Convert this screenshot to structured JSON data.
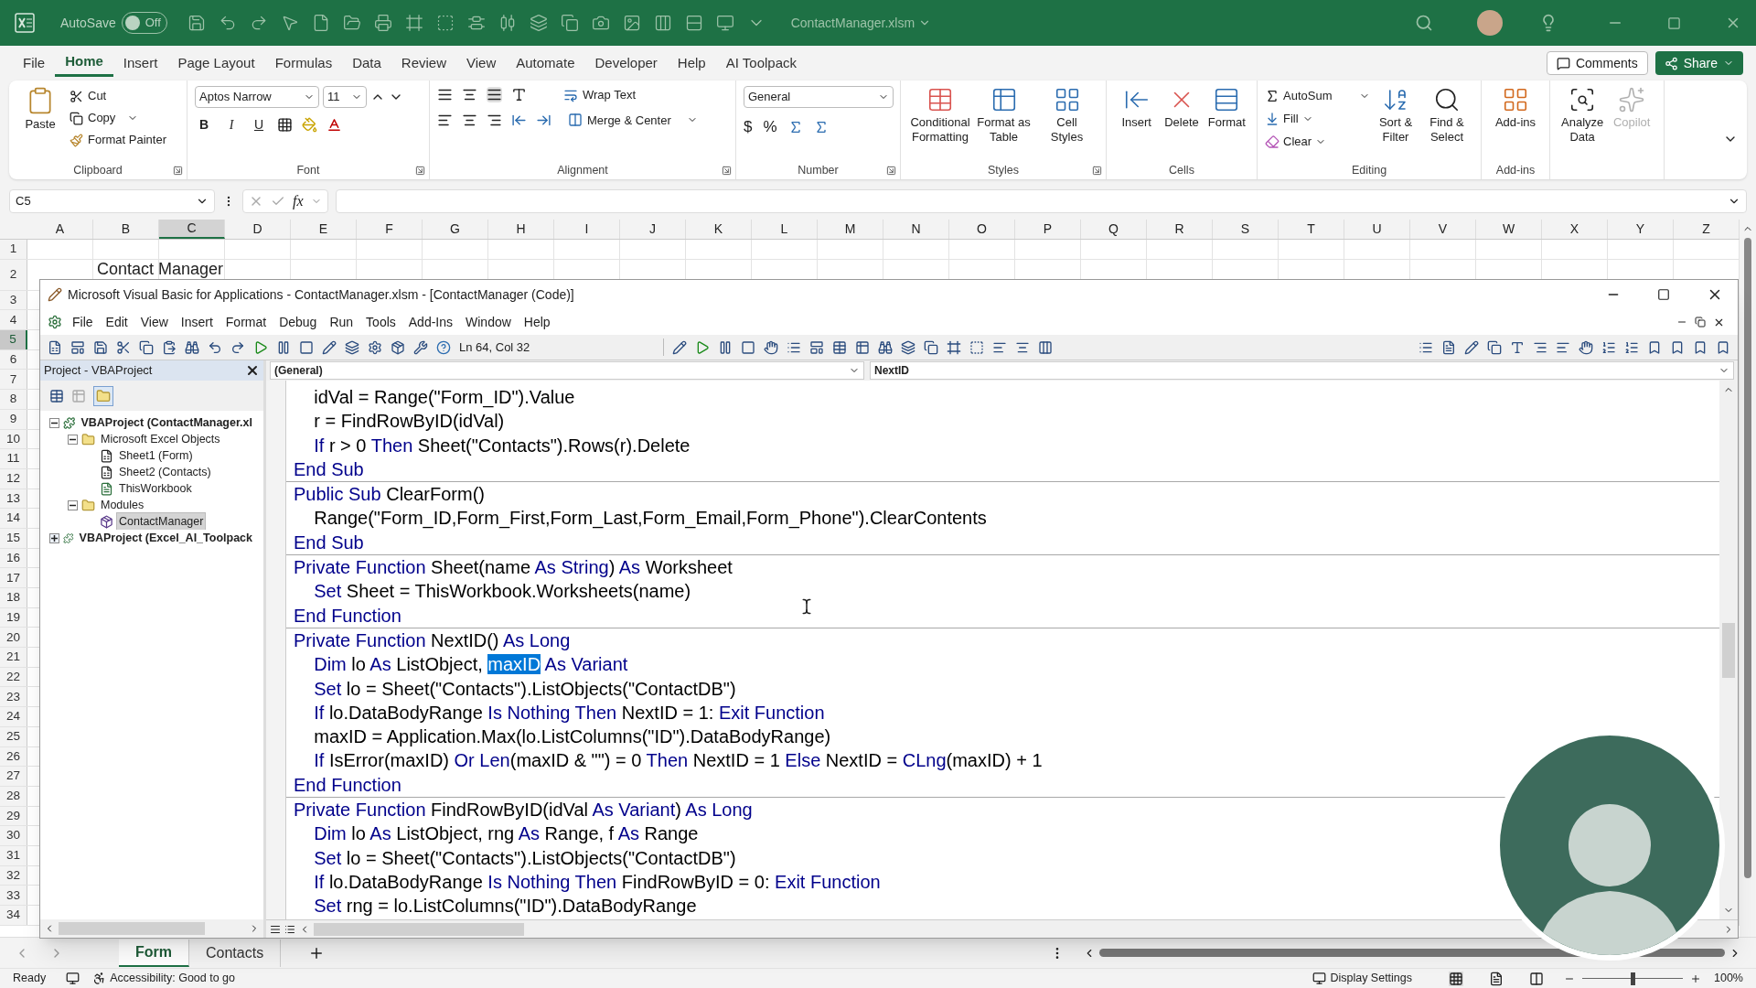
{
  "title_bar": {
    "autosave_label": "AutoSave",
    "autosave": {
      "on": false,
      "label": "Off"
    },
    "file_name": "ContactManager.xlsm"
  },
  "ribbon_tabs": [
    {
      "label": "File",
      "selected": false
    },
    {
      "label": "Home",
      "selected": true
    },
    {
      "label": "Insert",
      "selected": false
    },
    {
      "label": "Page Layout",
      "selected": false
    },
    {
      "label": "Formulas",
      "selected": false
    },
    {
      "label": "Data",
      "selected": false
    },
    {
      "label": "Review",
      "selected": false
    },
    {
      "label": "View",
      "selected": false
    },
    {
      "label": "Automate",
      "selected": false
    },
    {
      "label": "Developer",
      "selected": false
    },
    {
      "label": "Help",
      "selected": false
    },
    {
      "label": "AI Toolpack",
      "selected": false
    }
  ],
  "comments_button": "Comments",
  "share_button": "Share",
  "ribbon": {
    "clipboard": {
      "label": "Clipboard",
      "paste": "Paste",
      "cut": "Cut",
      "copy": "Copy",
      "format_painter": "Format Painter"
    },
    "font": {
      "label": "Font",
      "font_name": "Aptos Narrow",
      "font_size": "11",
      "styles": [
        "B",
        "I",
        "U"
      ]
    },
    "alignment": {
      "label": "Alignment",
      "wrap_text": "Wrap Text",
      "merge_center": "Merge & Center"
    },
    "number": {
      "label": "Number",
      "format": "General",
      "currency": "$",
      "percent": "%"
    },
    "styles": {
      "label": "Styles",
      "buttons": [
        "Conditional Formatting",
        "Format as Table",
        "Cell Styles"
      ]
    },
    "cells": {
      "label": "Cells",
      "buttons": [
        "Insert",
        "Delete",
        "Format"
      ]
    },
    "editing": {
      "label": "Editing",
      "autosum": "AutoSum",
      "fill": "Fill",
      "clear": "Clear",
      "buttons": [
        "Sort & Filter",
        "Find & Select"
      ]
    },
    "addins": {
      "label": "Add-ins",
      "button": "Add-ins"
    },
    "extra": [
      {
        "label": "Analyze Data",
        "disabled": false
      },
      {
        "label": "Copilot",
        "disabled": true
      }
    ]
  },
  "formula_bar": {
    "name_box": "C5",
    "function_label": "fx"
  },
  "sheet": {
    "columns": [
      {
        "label": "A",
        "selected": false
      },
      {
        "label": "B",
        "selected": false
      },
      {
        "label": "C",
        "selected": true
      },
      {
        "label": "D",
        "selected": false
      },
      {
        "label": "E",
        "selected": false
      },
      {
        "label": "F",
        "selected": false
      },
      {
        "label": "G",
        "selected": false
      },
      {
        "label": "H",
        "selected": false
      },
      {
        "label": "I",
        "selected": false
      },
      {
        "label": "J",
        "selected": false
      },
      {
        "label": "K",
        "selected": false
      },
      {
        "label": "L",
        "selected": false
      },
      {
        "label": "M",
        "selected": false
      },
      {
        "label": "N",
        "selected": false
      },
      {
        "label": "O",
        "selected": false
      },
      {
        "label": "P",
        "selected": false
      },
      {
        "label": "Q",
        "selected": false
      },
      {
        "label": "R",
        "selected": false
      },
      {
        "label": "S",
        "selected": false
      },
      {
        "label": "T",
        "selected": false
      },
      {
        "label": "U",
        "selected": false
      },
      {
        "label": "V",
        "selected": false
      },
      {
        "label": "W",
        "selected": false
      },
      {
        "label": "X",
        "selected": false
      },
      {
        "label": "Y",
        "selected": false
      },
      {
        "label": "Z",
        "selected": false
      }
    ],
    "rows": [
      {
        "label": "1",
        "selected": false
      },
      {
        "label": "2",
        "selected": false,
        "column_b": "Contact Manager"
      },
      {
        "label": "3",
        "selected": false
      },
      {
        "label": "4",
        "selected": false
      },
      {
        "label": "5",
        "selected": true
      },
      {
        "label": "6",
        "selected": false
      },
      {
        "label": "7",
        "selected": false
      },
      {
        "label": "8",
        "selected": false
      },
      {
        "label": "9",
        "selected": false
      },
      {
        "label": "10",
        "selected": false
      },
      {
        "label": "11",
        "selected": false
      },
      {
        "label": "12",
        "selected": false
      },
      {
        "label": "13",
        "selected": false
      },
      {
        "label": "14",
        "selected": false
      },
      {
        "label": "15",
        "selected": false
      },
      {
        "label": "16",
        "selected": false
      },
      {
        "label": "17",
        "selected": false
      },
      {
        "label": "18",
        "selected": false
      },
      {
        "label": "19",
        "selected": false
      },
      {
        "label": "20",
        "selected": false
      },
      {
        "label": "21",
        "selected": false
      },
      {
        "label": "22",
        "selected": false
      },
      {
        "label": "23",
        "selected": false
      },
      {
        "label": "24",
        "selected": false
      },
      {
        "label": "25",
        "selected": false
      },
      {
        "label": "26",
        "selected": false
      },
      {
        "label": "27",
        "selected": false
      },
      {
        "label": "28",
        "selected": false
      },
      {
        "label": "29",
        "selected": false
      },
      {
        "label": "30",
        "selected": false
      },
      {
        "label": "31",
        "selected": false
      },
      {
        "label": "32",
        "selected": false
      },
      {
        "label": "33",
        "selected": false
      },
      {
        "label": "34",
        "selected": false
      }
    ]
  },
  "vba": {
    "title": "Microsoft Visual Basic for Applications - ContactManager.xlsm - [ContactManager (Code)]",
    "menu": [
      "File",
      "Edit",
      "View",
      "Insert",
      "Format",
      "Debug",
      "Run",
      "Tools",
      "Add-Ins",
      "Window",
      "Help"
    ],
    "cursor_position": "Ln 64, Col 32",
    "project": {
      "title": "Project - VBAProject",
      "tree": [
        {
          "label": "VBAProject (ContactManager.xl",
          "kind": "project",
          "expanded": true,
          "selected": false,
          "children": [
            {
              "label": "Microsoft Excel Objects",
              "kind": "folder",
              "expanded": true,
              "selected": false,
              "children": [
                {
                  "label": "Sheet1 (Form)",
                  "kind": "sheet",
                  "selected": false
                },
                {
                  "label": "Sheet2 (Contacts)",
                  "kind": "sheet",
                  "selected": false
                },
                {
                  "label": "ThisWorkbook",
                  "kind": "workbook",
                  "selected": false
                }
              ]
            },
            {
              "label": "Modules",
              "kind": "folder",
              "expanded": true,
              "selected": false,
              "children": [
                {
                  "label": "ContactManager",
                  "kind": "module",
                  "selected": true
                }
              ]
            }
          ]
        },
        {
          "label": "VBAProject (Excel_AI_Toolpack",
          "kind": "project",
          "expanded": false,
          "selected": false
        }
      ]
    },
    "object_dropdown": "(General)",
    "procedure_dropdown": "NextID",
    "procedures": [
      {
        "lines": [
          [
            {
              "text": "    idVal = Range(\"Form_ID\").Value",
              "kind": "plain"
            }
          ],
          [
            {
              "text": "    r = FindRowByID(idVal)",
              "kind": "plain"
            }
          ],
          [
            {
              "text": "    If",
              "kind": "keyword"
            },
            {
              "text": " r > 0 ",
              "kind": "plain"
            },
            {
              "text": "Then",
              "kind": "keyword"
            },
            {
              "text": " Sheet(\"Contacts\").Rows(r).Delete",
              "kind": "plain"
            }
          ],
          [
            {
              "text": "End Sub",
              "kind": "keyword"
            }
          ]
        ]
      },
      {
        "lines": [
          [
            {
              "text": "Public Sub",
              "kind": "keyword"
            },
            {
              "text": " ClearForm()",
              "kind": "plain"
            }
          ],
          [
            {
              "text": "    Range(\"Form_ID,Form_First,Form_Last,Form_Email,Form_Phone\").ClearContents",
              "kind": "plain"
            }
          ],
          [
            {
              "text": "End Sub",
              "kind": "keyword"
            }
          ]
        ]
      },
      {
        "lines": [
          [
            {
              "text": "Private Function",
              "kind": "keyword"
            },
            {
              "text": " Sheet(name ",
              "kind": "plain"
            },
            {
              "text": "As String",
              "kind": "keyword"
            },
            {
              "text": ") ",
              "kind": "plain"
            },
            {
              "text": "As",
              "kind": "keyword"
            },
            {
              "text": " Worksheet",
              "kind": "plain"
            }
          ],
          [
            {
              "text": "    Set",
              "kind": "keyword"
            },
            {
              "text": " Sheet = ThisWorkbook.Worksheets(name)",
              "kind": "plain"
            }
          ],
          [
            {
              "text": "End Function",
              "kind": "keyword"
            }
          ]
        ]
      },
      {
        "lines": [
          [
            {
              "text": "Private Function",
              "kind": "keyword"
            },
            {
              "text": " NextID() ",
              "kind": "plain"
            },
            {
              "text": "As Long",
              "kind": "keyword"
            }
          ],
          [
            {
              "text": "    Dim",
              "kind": "keyword"
            },
            {
              "text": " lo ",
              "kind": "plain"
            },
            {
              "text": "As",
              "kind": "keyword"
            },
            {
              "text": " ListObject, ",
              "kind": "plain"
            },
            {
              "text": "maxID",
              "kind": "selected"
            },
            {
              "text": " As Variant",
              "kind": "keyword"
            }
          ],
          [
            {
              "text": "    Set",
              "kind": "keyword"
            },
            {
              "text": " lo = Sheet(\"Contacts\").ListObjects(\"ContactDB\")",
              "kind": "plain"
            }
          ],
          [
            {
              "text": "    If",
              "kind": "keyword"
            },
            {
              "text": " lo.DataBodyRange ",
              "kind": "plain"
            },
            {
              "text": "Is Nothing Then",
              "kind": "keyword"
            },
            {
              "text": " NextID = 1: ",
              "kind": "plain"
            },
            {
              "text": "Exit Function",
              "kind": "keyword"
            }
          ],
          [
            {
              "text": "    maxID = Application.Max(lo.ListColumns(\"ID\").DataBodyRange)",
              "kind": "plain"
            }
          ],
          [
            {
              "text": "    If",
              "kind": "keyword"
            },
            {
              "text": " IsError(maxID) ",
              "kind": "plain"
            },
            {
              "text": "Or Len",
              "kind": "keyword"
            },
            {
              "text": "(maxID & \"\") = 0 ",
              "kind": "plain"
            },
            {
              "text": "Then",
              "kind": "keyword"
            },
            {
              "text": " NextID = 1 ",
              "kind": "plain"
            },
            {
              "text": "Else",
              "kind": "keyword"
            },
            {
              "text": " NextID = ",
              "kind": "plain"
            },
            {
              "text": "CLng",
              "kind": "keyword"
            },
            {
              "text": "(maxID) + 1",
              "kind": "plain"
            }
          ],
          [
            {
              "text": "End Function",
              "kind": "keyword"
            }
          ]
        ]
      },
      {
        "lines": [
          [
            {
              "text": "Private Function",
              "kind": "keyword"
            },
            {
              "text": " FindRowByID(idVal ",
              "kind": "plain"
            },
            {
              "text": "As Variant",
              "kind": "keyword"
            },
            {
              "text": ") ",
              "kind": "plain"
            },
            {
              "text": "As Long",
              "kind": "keyword"
            }
          ],
          [
            {
              "text": "    Dim",
              "kind": "keyword"
            },
            {
              "text": " lo ",
              "kind": "plain"
            },
            {
              "text": "As",
              "kind": "keyword"
            },
            {
              "text": " ListObject, rng ",
              "kind": "plain"
            },
            {
              "text": "As",
              "kind": "keyword"
            },
            {
              "text": " Range, f ",
              "kind": "plain"
            },
            {
              "text": "As",
              "kind": "keyword"
            },
            {
              "text": " Range",
              "kind": "plain"
            }
          ],
          [
            {
              "text": "    Set",
              "kind": "keyword"
            },
            {
              "text": " lo = Sheet(\"Contacts\").ListObjects(\"ContactDB\")",
              "kind": "plain"
            }
          ],
          [
            {
              "text": "    If",
              "kind": "keyword"
            },
            {
              "text": " lo.DataBodyRange ",
              "kind": "plain"
            },
            {
              "text": "Is Nothing Then",
              "kind": "keyword"
            },
            {
              "text": " FindRowByID = 0: ",
              "kind": "plain"
            },
            {
              "text": "Exit Function",
              "kind": "keyword"
            }
          ],
          [
            {
              "text": "    Set",
              "kind": "keyword"
            },
            {
              "text": " rng = lo.ListColumns(\"ID\").DataBodyRange",
              "kind": "plain"
            }
          ]
        ]
      }
    ]
  },
  "sheet_tabs": [
    {
      "label": "Form",
      "selected": true
    },
    {
      "label": "Contacts",
      "selected": false
    }
  ],
  "status_bar": {
    "ready": "Ready",
    "accessibility": "Accessibility: Good to go",
    "display_settings": "Display Settings",
    "zoom": {
      "label": "100%",
      "level": 0.5
    }
  }
}
